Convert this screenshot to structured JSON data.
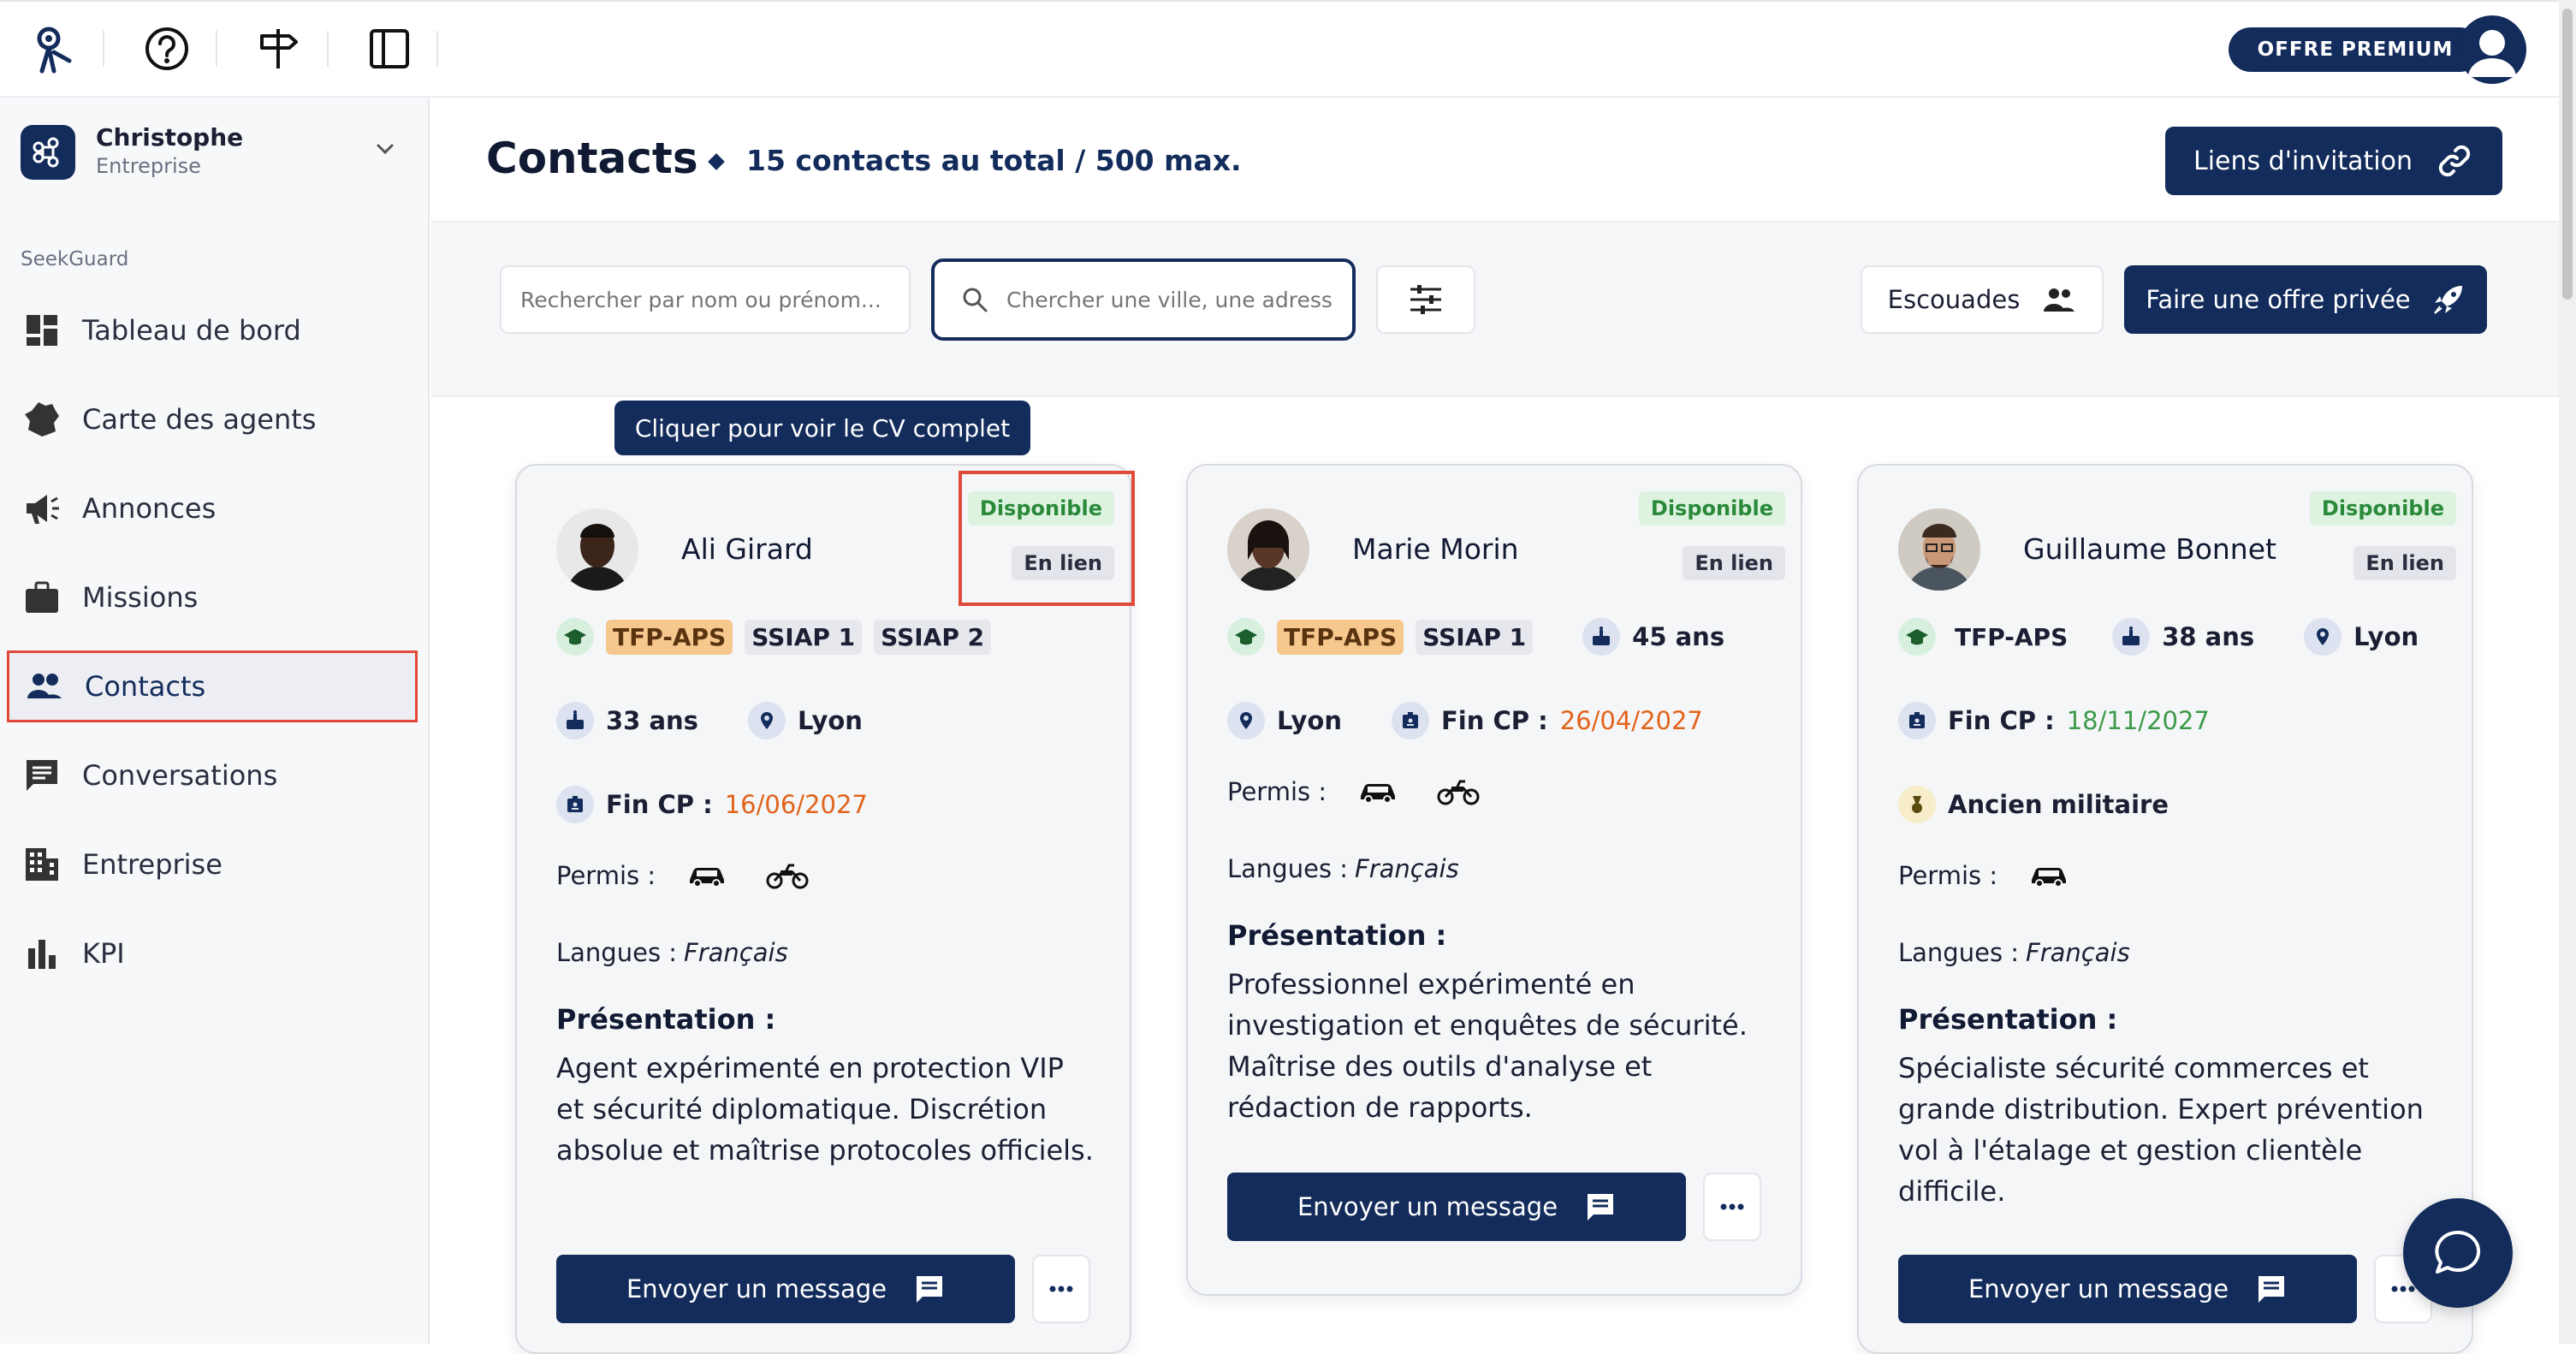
{
  "premium_label": "OFFRE PREMIUM",
  "workspace": {
    "name": "Christophe",
    "type": "Entreprise"
  },
  "sidebar": {
    "section": "SeekGuard",
    "items": [
      {
        "label": "Tableau de bord",
        "icon": "dashboard-icon"
      },
      {
        "label": "Carte des agents",
        "icon": "france-map-icon"
      },
      {
        "label": "Annonces",
        "icon": "megaphone-icon"
      },
      {
        "label": "Missions",
        "icon": "briefcase-icon"
      },
      {
        "label": "Contacts",
        "icon": "people-icon",
        "active": true
      },
      {
        "label": "Conversations",
        "icon": "chat-icon"
      },
      {
        "label": "Entreprise",
        "icon": "building-icon"
      },
      {
        "label": "KPI",
        "icon": "bar-chart-icon"
      }
    ]
  },
  "header": {
    "title": "Contacts",
    "count": "15 contacts au total / 500 max.",
    "invite_label": "Liens d'invitation"
  },
  "filters": {
    "name_placeholder": "Rechercher par nom ou prénom...",
    "city_placeholder": "Chercher une ville, une adresse",
    "squads_label": "Escouades",
    "offer_label": "Faire une offre privée"
  },
  "tooltip": "Cliquer pour voir le CV complet",
  "labels": {
    "fin_cp": "Fin CP :",
    "permis": "Permis :",
    "langues": "Langues :",
    "presentation": "Présentation :",
    "send_message": "Envoyer un message",
    "ancien_militaire": "Ancien militaire"
  },
  "cards": [
    {
      "name": "Ali Girard",
      "status": "Disponible",
      "relation": "En lien",
      "certifications": [
        "TFP-APS",
        "SSIAP 1",
        "SSIAP 2"
      ],
      "age": "33 ans",
      "city": "Lyon",
      "fin_cp": "16/06/2027",
      "permis": [
        "car",
        "motorcycle"
      ],
      "langue": "Français",
      "presentation": "Agent expérimenté en protection VIP et sécurité diplomatique. Discrétion absolue et maîtrise protocoles officiels."
    },
    {
      "name": "Marie Morin",
      "status": "Disponible",
      "relation": "En lien",
      "certifications": [
        "TFP-APS",
        "SSIAP 1"
      ],
      "age": "45 ans",
      "city": "Lyon",
      "fin_cp": "26/04/2027",
      "permis": [
        "car",
        "motorcycle"
      ],
      "langue": "Français",
      "presentation": "Professionnel expérimenté en investigation et enquêtes de sécurité. Maîtrise des outils d'analyse et rédaction de rapports."
    },
    {
      "name": "Guillaume Bonnet",
      "status": "Disponible",
      "relation": "En lien",
      "certifications": [
        "TFP-APS"
      ],
      "age": "38 ans",
      "city": "Lyon",
      "fin_cp": "18/11/2027",
      "permis": [
        "car"
      ],
      "langue": "Français",
      "presentation": "Spécialiste sécurité commerces et grande distribution. Expert prévention vol à l'étalage et gestion clientèle difficile."
    }
  ],
  "colors": {
    "primary": "#132c5b",
    "highlight": "#e04a3a",
    "available": "#2a8a3a",
    "date_orange": "#e2641b",
    "date_green": "#3c9a4a"
  }
}
